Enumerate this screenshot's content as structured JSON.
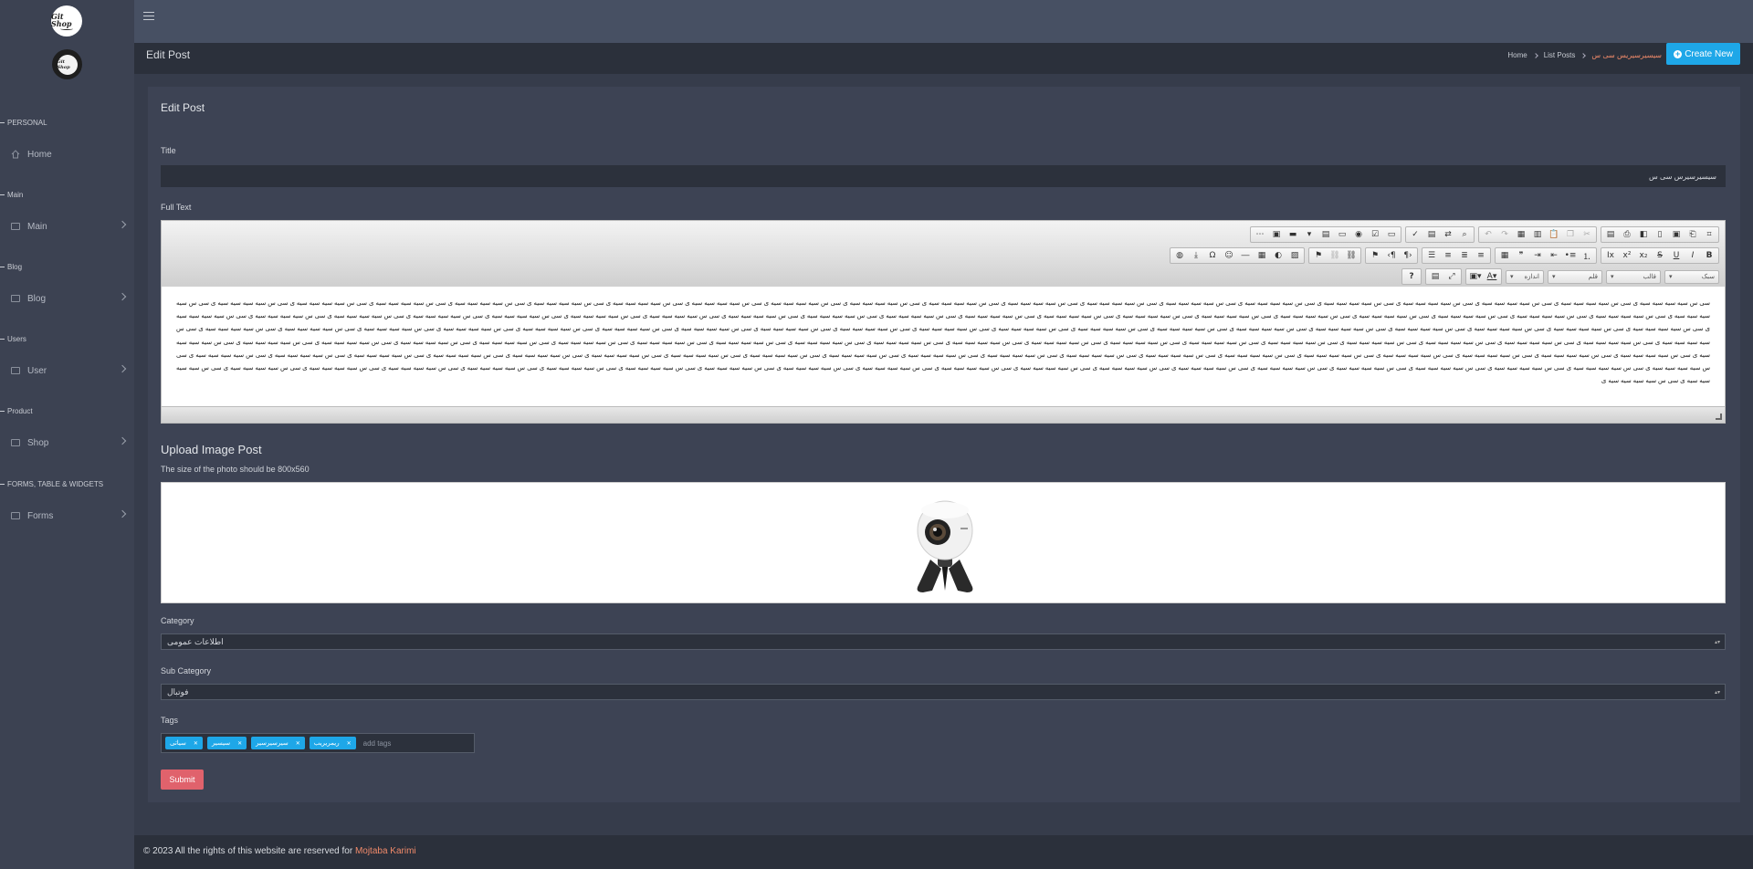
{
  "sidebar": {
    "logo_text": "Git Shop",
    "sections": [
      {
        "label": "PERSONAL",
        "items": [
          {
            "label": "Home",
            "icon": "home-icon"
          }
        ]
      },
      {
        "label": "Main",
        "items": [
          {
            "label": "Main",
            "icon": "monitor-icon"
          }
        ]
      },
      {
        "label": "Blog",
        "items": [
          {
            "label": "Blog",
            "icon": "monitor-icon"
          }
        ]
      },
      {
        "label": "Users",
        "items": [
          {
            "label": "User",
            "icon": "monitor-icon"
          }
        ]
      },
      {
        "label": "Product",
        "items": [
          {
            "label": "Shop",
            "icon": "monitor-icon"
          }
        ]
      },
      {
        "label": "FORMS, TABLE & WIDGETS",
        "items": [
          {
            "label": "Forms",
            "icon": "monitor-icon"
          }
        ]
      }
    ]
  },
  "header": {
    "title": "Edit Post",
    "breadcrumb": [
      "Home",
      "List Posts",
      "سیسیرسیریس سی س"
    ],
    "create_label": "Create New"
  },
  "form": {
    "card_title": "Edit Post",
    "title_label": "Title",
    "title_value": "سیسیرسیرس سی س",
    "fulltext_label": "Full Text",
    "fulltext_value": "سی س سیه سیه سیه سیه ی سی س سیه سیه سیه سیه ی سی س سیه سیه سیه سیه ی سی س سیه سیه سیه سیه ی سی س سیه سیه سیه سیه ی سی س سیه سیه سیه سیه ی سی س سیه سیه سیه سیه ی سی س سیه سیه سیه سیه ی سی س سیه سیه سیه سیه ی سی س سیه سیه سیه سیه ی سی س سیه سیه سیه سیه ی سی س سیه سیه سیه سیه ی سی س سیه سیه سیه سیه ی سی س سیه سیه سیه سیه ی سی س سیه سیه سیه سیه ی سی س سیه سیه سیه سیه ی سی س سیه سیه سیه سیه ی سی س سیه سیه سیه سیه ی سی س سیه سیه سیه سیه ی سی س سیه سیه سیه سیه ی سی س سیه سیه سیه سیه ی سی س سیه سیه سیه سیه ی سی س سیه سیه سیه سیه ی سی س سیه سیه سیه سیه ی سی س سیه سیه سیه سیه ی سی س سیه سیه سیه سیه ی سی س سیه سیه سیه سیه ی سی س سیه سیه سیه سیه ی سی س سیه سیه سیه سیه ی سی س سیه سیه سیه سیه ی سی س سیه سیه سیه سیه ی سی س سیه سیه سیه سیه ی سی س سیه سیه سیه سیه ی سی س سیه سیه سیه سیه ی سی س سیه سیه سیه سیه ی سی س سیه سیه سیه سیه ی سی س سیه سیه سیه سیه ی سی س سیه سیه سیه سیه ی سی س سیه سیه سیه سیه ی سی س سیه سیه سیه سیه ی سی س سیه سیه سیه سیه ی سی س سیه سیه سیه سیه ی سی س سیه سیه سیه سیه ی سی س سیه سیه سیه سیه ی سی س سیه سیه سیه سیه ی سی س سیه سیه سیه سیه ی سی س سیه سیه سیه سیه ی سی س سیه سیه سیه سیه ی سی س سیه سیه سیه سیه ی سی س سیه سیه سیه سیه ی سی س سیه سیه سیه سیه ی سی س سیه سیه سیه سیه ی سی س سیه سیه سیه سیه ی سی س سیه سیه سیه سیه ی سی س سیه سیه سیه سیه ی سی س سیه سیه سیه سیه ی سی س سیه سیه سیه سیه ی سی س سیه سیه سیه سیه ی سی س سیه سیه سیه سیه ی سی س سیه سیه سیه سیه ی سی س سیه سیه سیه سیه ی سی س سیه سیه سیه سیه ی سی س سیه سیه سیه سیه ی سی س سیه سیه سیه سیه ی سی س سیه سیه سیه سیه ی سی س سیه سیه سیه سیه ی سی س سیه سیه سیه سیه ی سی س سیه سیه سیه سیه ی سی س سیه سیه سیه سیه ی سی س سیه سیه سیه سیه ی سی س سیه سیه سیه سیه ی سی س سیه سیه سیه سیه ی سی س سیه سیه سیه سیه ی سی س سیه سیه سیه سیه ی سی س سیه سیه سیه سیه ی سی س سیه سیه سیه سیه ی سی س سیه سیه سیه سیه ی سی س سیه سیه سیه سیه ی سی س سیه سیه سیه سیه ی سی س سیه سیه سیه سیه ی سی س سیه سیه سیه سیه ی سی س سیه سیه سیه سیه ی سی س سیه سیه سیه سیه ی سی س سیه سیه سیه سیه ی سی س سیه سیه سیه سیه ی سی س سیه سیه سیه سیه ی سی س سیه سیه سیه سیه ی سی س سیه سیه سیه سیه ی سی س سیه سیه سیه سیه ی سی س سیه سیه سیه سیه ی سی س سیه سیه سیه سیه ی سی س سیه سیه سیه سیه ی سی س سیه سیه سیه سیه ی سی س سیه سیه سیه سیه ی سی س سیه سیه سیه سیه ی سی س سیه سیه سیه سیه ی سی س سیه سیه سیه سیه ی سی س سیه سیه سیه سیه ی سی س سیه سیه سیه سیه ی سی س سیه سیه سیه سیه ی سی س سیه سیه سیه سیه ی سی س سیه سیه سیه سیه ی سی س سیه سیه سیه سیه ی سی س سیه سیه سیه سیه ی سی س سیه سیه سیه سیه ی سی س سیه سیه سیه سیه ی سی س سیه سیه سیه سیه ی سی س سیه سیه سیه سیه ی سی س سیه سیه سیه سیه ی سی س سیه سیه سیه سیه ی سی س سیه سیه سیه سیه ی سی س سیه سیه سیه سیه ی سی س سیه سیه سیه سیه ی سی س سیه سیه سیه سیه ی سی س سیه سیه سیه سیه ی سی س سیه سیه سیه سیه ی سی س سیه سیه سیه سیه ی سی س سیه سیه سیه سیه ی",
    "toolbar_selects": [
      "سبک",
      "قالب",
      "قلم",
      "اندازه"
    ],
    "upload_title": "Upload Image Post",
    "upload_hint": "The size of the photo should be 800x560",
    "category_label": "Category",
    "category_value": "اطلاعات عمومی",
    "subcategory_label": "Sub Category",
    "subcategory_value": "فوتبال",
    "tags_label": "Tags",
    "tags": [
      "سیاتی",
      "سیسیر",
      "سیرسیرسیر",
      "ریمریریب"
    ],
    "tags_placeholder": "add tags",
    "submit_label": "Submit"
  },
  "footer": {
    "text": "© 2023 All the rights of this website are reserved for ",
    "author": "Mojtaba Karimi"
  },
  "colors": {
    "accent": "#1ea7e8",
    "danger": "#e0626c",
    "link": "#f08a6a"
  }
}
